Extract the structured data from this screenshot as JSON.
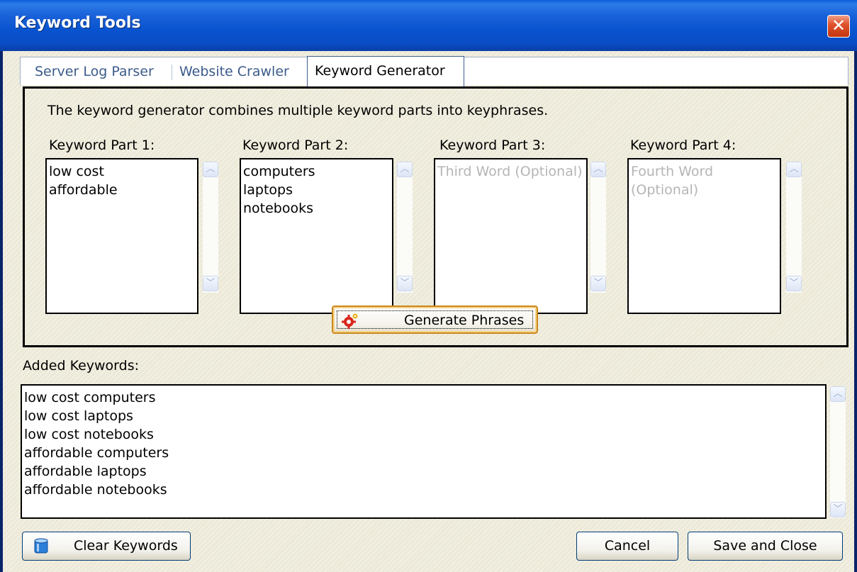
{
  "window": {
    "title": "Keyword Tools",
    "close_glyph": "✕"
  },
  "tabs": [
    {
      "label": "Server Log Parser",
      "active": false
    },
    {
      "label": "Website Crawler",
      "active": false
    },
    {
      "label": "Keyword Generator",
      "active": true
    }
  ],
  "generator": {
    "description": "The keyword generator combines multiple keyword parts into keyphrases.",
    "parts": [
      {
        "label": "Keyword Part 1:",
        "value": "low cost\naffordable",
        "placeholder": ""
      },
      {
        "label": "Keyword Part 2:",
        "value": "computers\nlaptops\nnotebooks",
        "placeholder": ""
      },
      {
        "label": "Keyword Part 3:",
        "value": "",
        "placeholder": "Third Word (Optional)"
      },
      {
        "label": "Keyword Part 4:",
        "value": "",
        "placeholder": "Fourth Word\n(Optional)"
      }
    ],
    "generate_button": "Generate Phrases",
    "generate_icon": "gear-icon"
  },
  "added": {
    "label": "Added Keywords:",
    "value": "low cost computers\nlow cost laptops\nlow cost notebooks\naffordable computers\naffordable laptops\naffordable notebooks"
  },
  "buttons": {
    "clear": "Clear Keywords",
    "clear_icon": "database-icon",
    "cancel": "Cancel",
    "save": "Save and Close"
  },
  "scroll_glyphs": {
    "up": "︿",
    "down": "﹀"
  },
  "colors": {
    "titlebar": "#0853cf",
    "dialog_bg": "#ece9d8",
    "close_button": "#e0542e",
    "focus_border": "#c98a1e"
  }
}
